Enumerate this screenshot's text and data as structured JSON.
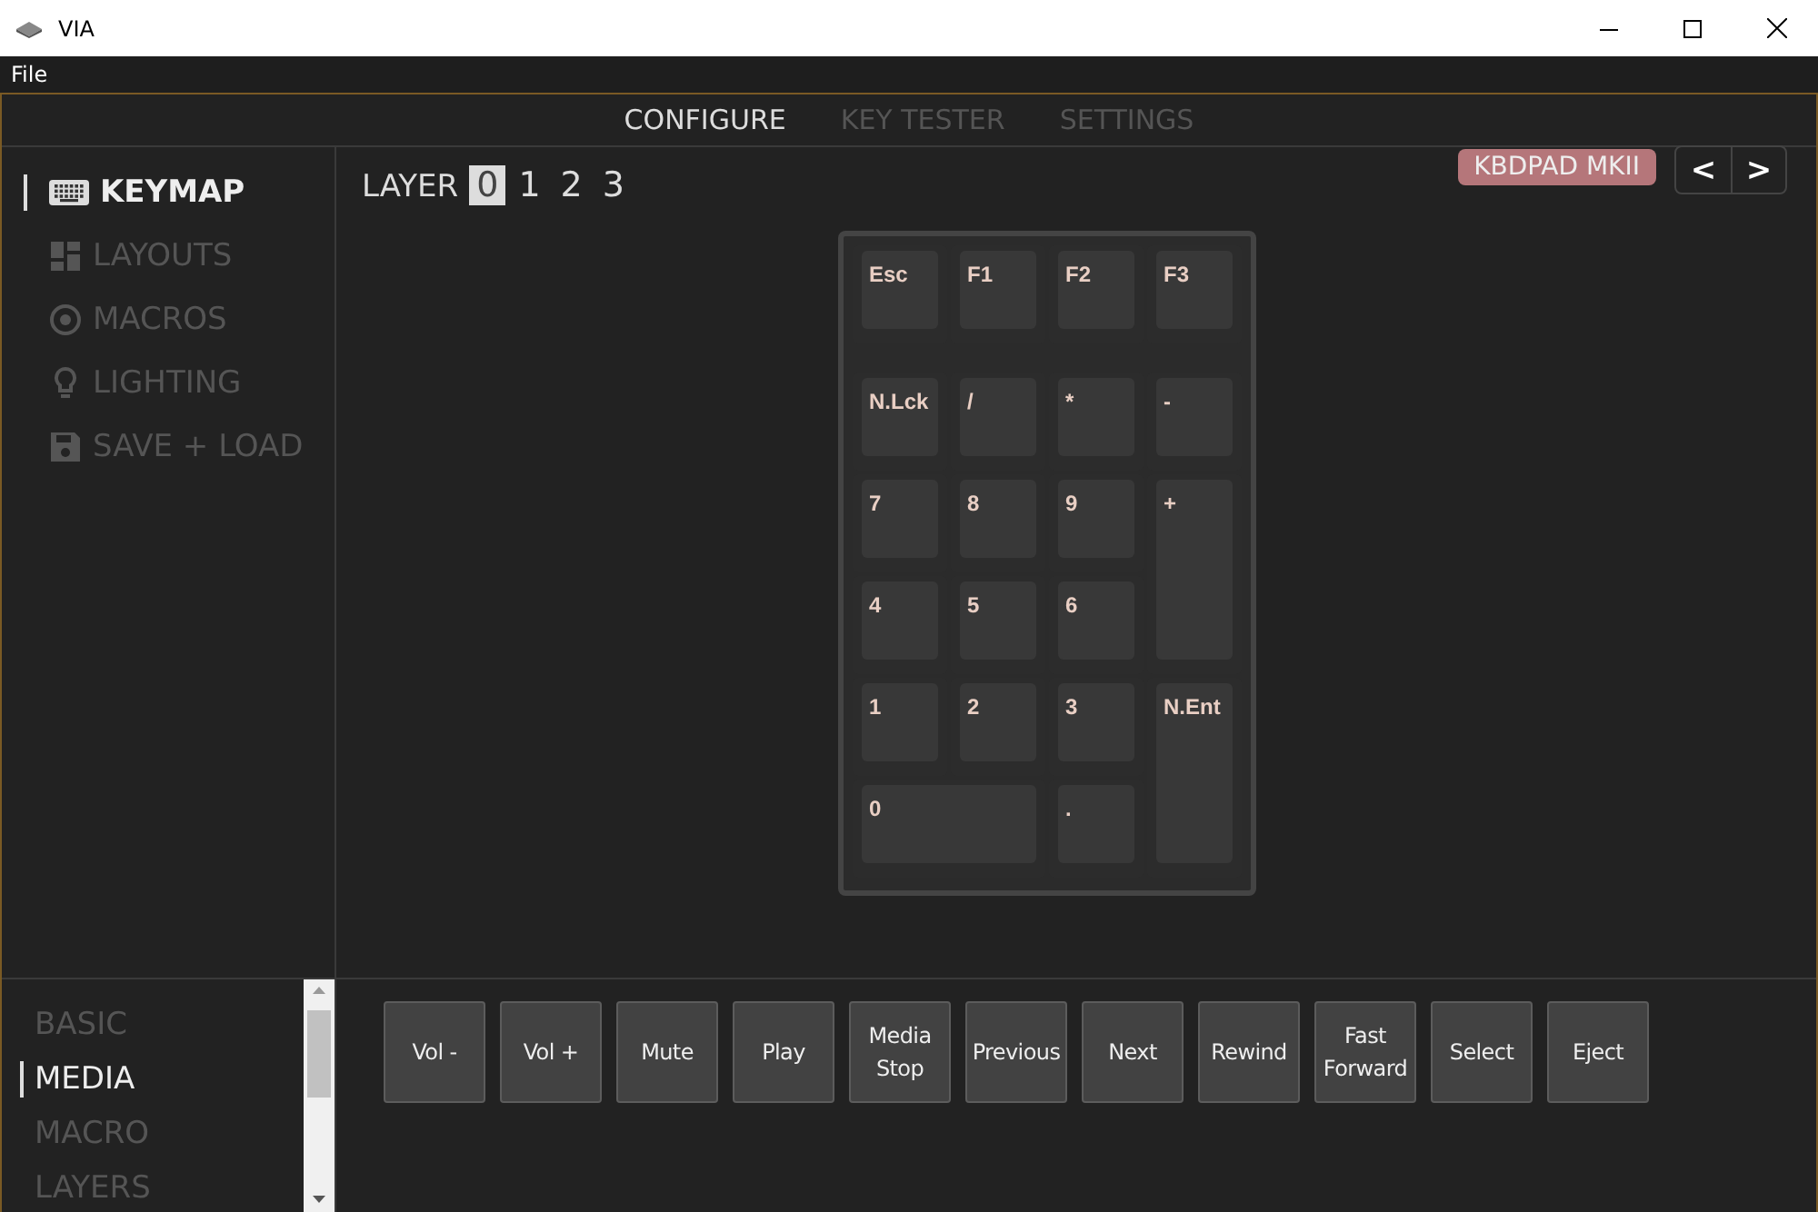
{
  "window": {
    "title": "VIA"
  },
  "menu": [
    "File"
  ],
  "tabs": [
    {
      "label": "CONFIGURE",
      "selected": true
    },
    {
      "label": "KEY TESTER",
      "selected": false
    },
    {
      "label": "SETTINGS",
      "selected": false
    }
  ],
  "sidebar": {
    "items": [
      {
        "label": "KEYMAP",
        "kind": "keyboard",
        "selected": true
      },
      {
        "label": "LAYOUTS",
        "kind": "layouts",
        "selected": false
      },
      {
        "label": "MACROS",
        "kind": "macros",
        "selected": false
      },
      {
        "label": "LIGHTING",
        "kind": "lighting",
        "selected": false
      },
      {
        "label": "SAVE + LOAD",
        "kind": "save",
        "selected": false
      }
    ]
  },
  "layers": {
    "label": "LAYER",
    "items": [
      {
        "label": "0",
        "selected": true
      },
      {
        "label": "1",
        "selected": false
      },
      {
        "label": "2",
        "selected": false
      },
      {
        "label": "3",
        "selected": false
      }
    ]
  },
  "device": {
    "name": "KBDPAD MKII",
    "prev": "<",
    "next": ">"
  },
  "keys": [
    "Esc",
    "F1",
    "F2",
    "F3",
    "N.Lck",
    "/",
    "*",
    "-",
    "7",
    "8",
    "9",
    "+",
    "4",
    "5",
    "6",
    "1",
    "2",
    "3",
    "N.Ent",
    "0",
    "."
  ],
  "categories": [
    {
      "label": "BASIC",
      "selected": false
    },
    {
      "label": "MEDIA",
      "selected": true
    },
    {
      "label": "MACRO",
      "selected": false
    },
    {
      "label": "LAYERS",
      "selected": false
    }
  ],
  "media_keys": [
    "Vol -",
    "Vol +",
    "Mute",
    "Play",
    "Media Stop",
    "Previous",
    "Next",
    "Rewind",
    "Fast Forward",
    "Select",
    "Eject"
  ]
}
